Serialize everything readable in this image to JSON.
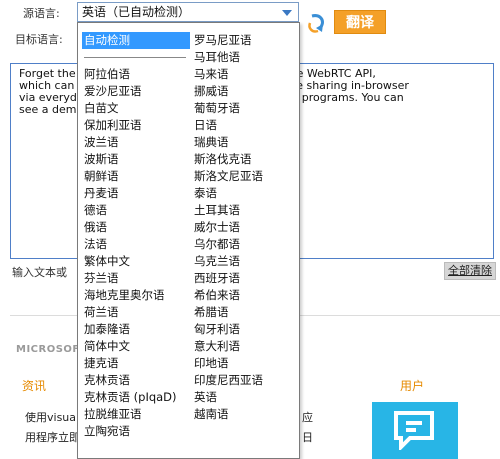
{
  "header": {
    "source_label": "源语言:",
    "target_label": "目标语言:",
    "source_selected": "英语（已自动检测）",
    "translate_label": "翻译"
  },
  "input": {
    "text": "Forget the                                      ra all support the WebRTC API,\nwhich can                                        peer-to-peer file sharing in-browser\nvia everyd                                        ons or desktop programs. You can\nsee a dem",
    "hint": "输入文本或",
    "clear_label": "全部清除"
  },
  "panel": {
    "ms_title": "MICROSOF",
    "news_title": "资讯",
    "users_title": "用户",
    "blurb_line1": "使用visua",
    "blurb_line2": "用程序立即",
    "blurb_tail1": "应",
    "blurb_tail2": "日",
    "tile_color": "#28b5e6"
  },
  "dropdown": {
    "left": [
      "自动检测",
      "",
      "阿拉伯语",
      "爱沙尼亚语",
      "白苗文",
      "保加利亚语",
      "波兰语",
      "波斯语",
      "朝鲜语",
      "丹麦语",
      "德语",
      "俄语",
      "法语",
      "繁体中文",
      "芬兰语",
      "海地克里奥尔语",
      "荷兰语",
      "加泰隆语",
      "简体中文",
      "捷克语",
      "克林贡语",
      "克林贡语 (pIqaD)",
      "拉脱维亚语",
      "立陶宛语"
    ],
    "right": [
      "罗马尼亚语",
      "马耳他语",
      "马来语",
      "挪威语",
      "葡萄牙语",
      "日语",
      "瑞典语",
      "斯洛伐克语",
      "斯洛文尼亚语",
      "泰语",
      "土耳其语",
      "威尔士语",
      "乌尔都语",
      "乌克兰语",
      "西班牙语",
      "希伯来语",
      "希腊语",
      "匈牙利语",
      "意大利语",
      "印地语",
      "印度尼西亚语",
      "英语",
      "越南语"
    ],
    "selected": "自动检测",
    "highlight_color": "#3399ff"
  }
}
